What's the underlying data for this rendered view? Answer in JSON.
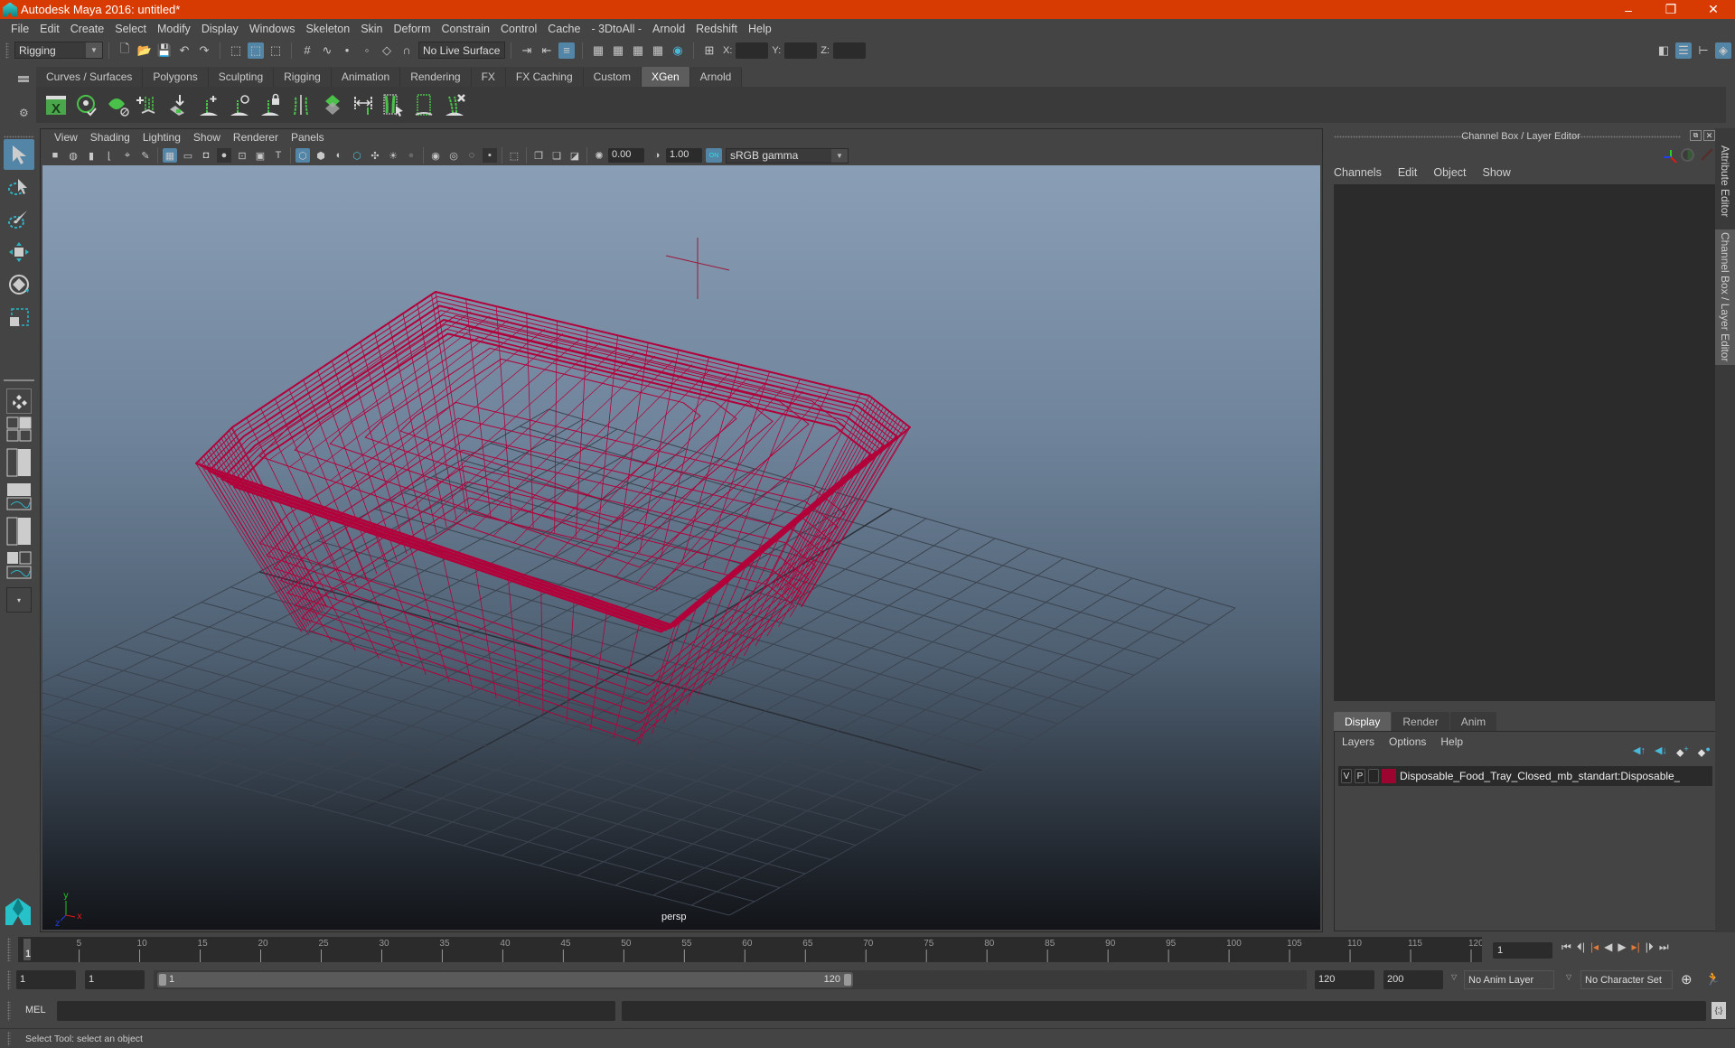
{
  "window": {
    "title": "Autodesk Maya 2016: untitled*",
    "controls": {
      "minimize": "–",
      "restore": "❐",
      "close": "✕"
    }
  },
  "menubar": {
    "items": [
      "File",
      "Edit",
      "Create",
      "Select",
      "Modify",
      "Display",
      "Windows",
      "Skeleton",
      "Skin",
      "Deform",
      "Constrain",
      "Control",
      "Cache",
      "- 3DtoAll -",
      "Arnold",
      "Redshift",
      "Help"
    ]
  },
  "toolbar": {
    "menuset": "Rigging",
    "live_surface": "No Live Surface",
    "coord_labels": {
      "x": "X:",
      "y": "Y:",
      "z": "Z:"
    },
    "coord_values": {
      "x": "",
      "y": "",
      "z": ""
    }
  },
  "shelf": {
    "tabs": [
      "Curves / Surfaces",
      "Polygons",
      "Sculpting",
      "Rigging",
      "Animation",
      "Rendering",
      "FX",
      "FX Caching",
      "Custom",
      "XGen",
      "Arnold"
    ],
    "active_tab": "XGen",
    "icons": [
      "xgen-editor-icon",
      "xgen-preview-icon",
      "xgen-clear-preview-icon",
      "add-guides-icon",
      "add-sample-guide-icon",
      "add-guide-icon",
      "sculpt-guide-icon",
      "lock-guide-icon",
      "guide-length-icon",
      "grooming-icon",
      "flip-guides-icon",
      "select-guides-icon",
      "guide-region-icon",
      "delete-guide-icon"
    ]
  },
  "viewport": {
    "menu": [
      "View",
      "Shading",
      "Lighting",
      "Show",
      "Renderer",
      "Panels"
    ],
    "exposure": "0.00",
    "gamma": "1.00",
    "color_mgmt": "ON",
    "color_space": "sRGB gamma",
    "camera_label": "persp",
    "axis": {
      "x": "x",
      "y": "y",
      "z": "z"
    },
    "wireframe_color": "#b3003a"
  },
  "channel_box": {
    "title": "Channel Box / Layer Editor",
    "menu": [
      "Channels",
      "Edit",
      "Object",
      "Show"
    ],
    "layer_tabs": [
      "Display",
      "Render",
      "Anim"
    ],
    "active_layer_tab": "Display",
    "layer_menu": [
      "Layers",
      "Options",
      "Help"
    ],
    "layers": [
      {
        "visible": "V",
        "playback": "P",
        "color": "#9b0530",
        "name": "Disposable_Food_Tray_Closed_mb_standart:Disposable_"
      }
    ]
  },
  "side_tabs": [
    "Attribute Editor",
    "Channel Box / Layer Editor"
  ],
  "timeline": {
    "ticks": [
      "5",
      "10",
      "15",
      "20",
      "25",
      "30",
      "35",
      "40",
      "45",
      "50",
      "55",
      "60",
      "65",
      "70",
      "75",
      "80",
      "85",
      "90",
      "95",
      "100",
      "105",
      "110",
      "115",
      "120"
    ],
    "current_frame_marker": "1",
    "current_frame": "1"
  },
  "range": {
    "start": "1",
    "anim_start": "1",
    "slider_start": "1",
    "slider_end": "120",
    "end": "120",
    "anim_end": "200",
    "anim_layer": "No Anim Layer",
    "character_set": "No Character Set"
  },
  "command_line": {
    "label": "MEL",
    "value": ""
  },
  "help_line": "Select Tool: select an object"
}
